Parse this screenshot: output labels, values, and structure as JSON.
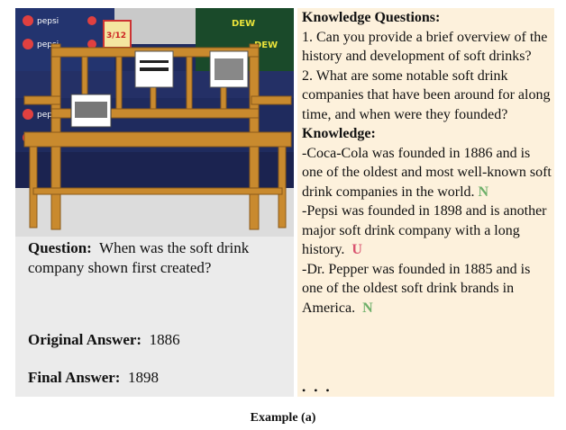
{
  "photo": {
    "alt": "Wooden bench in front of stacked soda cases",
    "signs": [
      "3/12",
      "pepsi",
      "pepsi",
      "pepsi",
      "pepsi",
      "DEW",
      "DEW"
    ]
  },
  "left": {
    "question_label": "Question:",
    "question_text": "When was the soft drink company shown first created?",
    "original_label": "Original Answer:",
    "original_value": "1886",
    "final_label": "Final Answer:",
    "final_value": "1898"
  },
  "right": {
    "kq_heading": "Knowledge Questions:",
    "kq_1": "1. Can you provide a brief overview of the history and development of soft drinks?",
    "kq_2": "2. What are some notable soft drink companies that have been around for along time, and when were they founded?",
    "k_heading": "Knowledge:",
    "k_1": "-Coca-Cola was founded in 1886 and is one of the oldest and most well-known soft drink companies in the world.",
    "k_1_mark": "N",
    "k_2": "-Pepsi was founded in 1898 and is another major soft drink company with a long history.",
    "k_2_mark": "U",
    "k_3": "-Dr. Pepper was founded in 1885 and is one of the oldest soft drink brands in America.",
    "k_3_mark": "N",
    "ellipsis": "• • •"
  },
  "caption": "Example (a)",
  "colors": {
    "mark_n": "#6eb06a",
    "mark_u": "#d9536f",
    "left_bg": "#ebebeb",
    "right_bg": "#fdf1dc"
  }
}
